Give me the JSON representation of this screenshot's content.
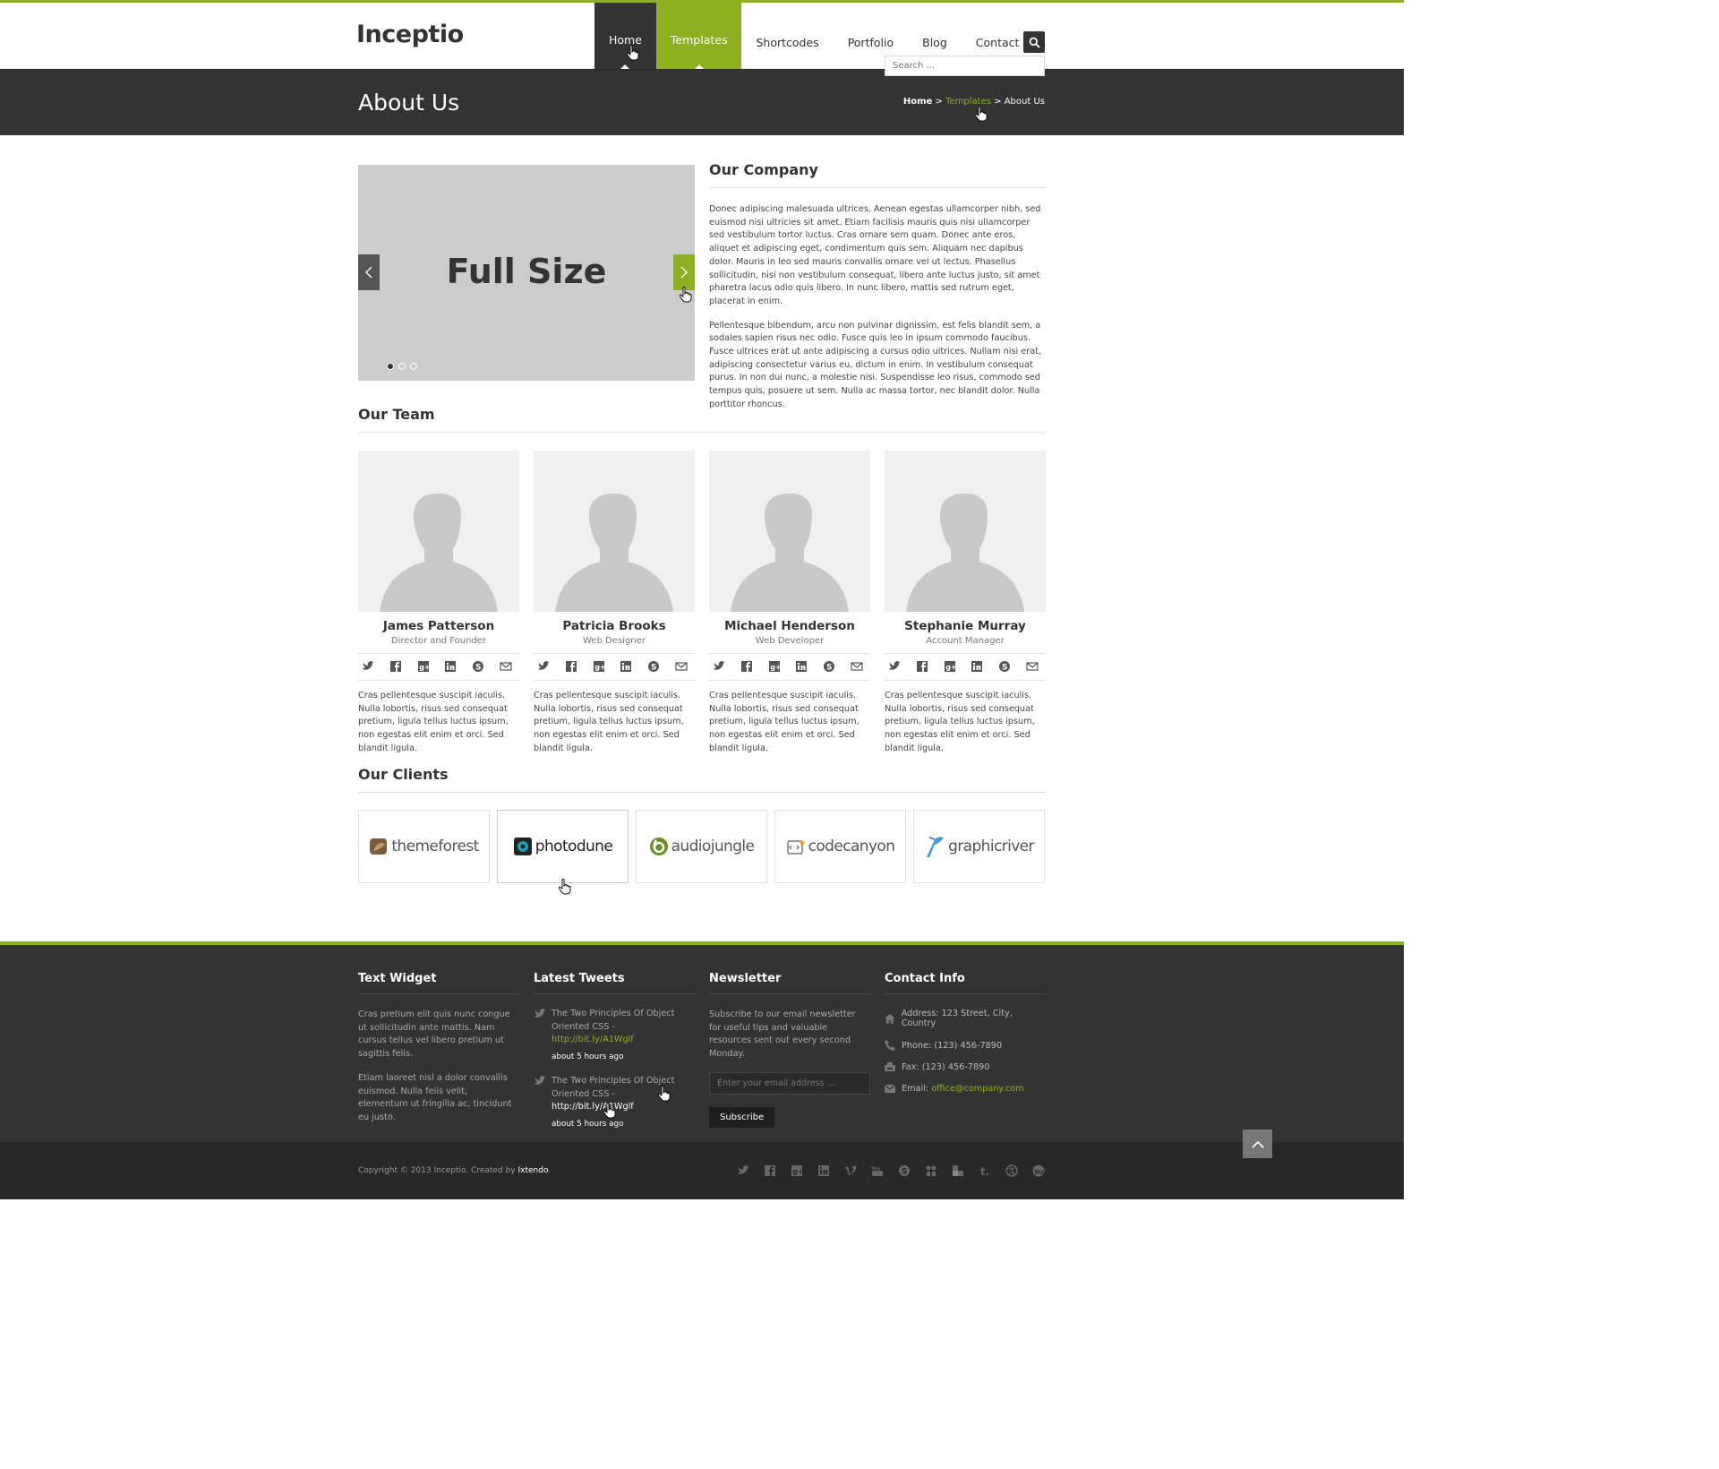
{
  "header": {
    "logo": "Inceptio",
    "nav": [
      "Home",
      "Templates",
      "Shortcodes",
      "Portfolio",
      "Blog",
      "Contact"
    ],
    "search_placeholder": "Search ..."
  },
  "page": {
    "title": "About Us",
    "breadcrumb": {
      "home": "Home",
      "sep": ">",
      "templates": "Templates",
      "current": "About Us"
    }
  },
  "slider": {
    "text": "Full Size",
    "dots": 3,
    "active_dot": 1
  },
  "company": {
    "heading": "Our Company",
    "paragraphs": [
      "Donec adipiscing malesuada ultrices. Aenean egestas ullamcorper nibh, sed euismod nisi ultricies sit amet. Etiam facilisis mauris quis nisi ullamcorper sed vestibulum tortor luctus. Cras ornare sem quam. Donec ante eros, aliquet et adipiscing eget, condimentum quis sem. Aliquam nec dapibus dolor. Mauris in leo sed mauris convallis ornare vel ut lectus. Phasellus sollicitudin, nisi non vestibulum consequat, libero ante luctus justo, sit amet pharetra lacus odio quis libero. In nunc libero, mattis sed rutrum eget, placerat in enim.",
      "Pellentesque bibendum, arcu non pulvinar dignissim, est felis blandit sem, a sodales sapien risus nec odio. Fusce quis leo in ipsum commodo faucibus. Fusce ultrices erat ut ante adipiscing a cursus odio ultrices. Nullam nisi erat, adipiscing consectetur varius eu, dictum in enim. In vestibulum consequat purus. In non dui nunc, a molestie nisi. Suspendisse leo risus, commodo sed tempus quis, posuere ut sem. Nulla ac massa tortor, nec blandit dolor. Nulla porttitor rhoncus."
    ]
  },
  "team": {
    "heading": "Our Team",
    "members": [
      {
        "name": "James Patterson",
        "role": "Director and Founder",
        "bio": "Cras pellentesque suscipit iaculis. Nulla lobortis, risus sed consequat pretium, ligula tellus luctus ipsum, non egestas elit enim et orci. Sed blandit ligula."
      },
      {
        "name": "Patricia Brooks",
        "role": "Web Designer",
        "bio": "Cras pellentesque suscipit iaculis. Nulla lobortis, risus sed consequat pretium, ligula tellus luctus ipsum, non egestas elit enim et orci. Sed blandit ligula."
      },
      {
        "name": "Michael Henderson",
        "role": "Web Developer",
        "bio": "Cras pellentesque suscipit iaculis. Nulla lobortis, risus sed consequat pretium, ligula tellus luctus ipsum, non egestas elit enim et orci. Sed blandit ligula."
      },
      {
        "name": "Stephanie Murray",
        "role": "Account Manager",
        "bio": "Cras pellentesque suscipit iaculis. Nulla lobortis, risus sed consequat pretium, ligula tellus luctus ipsum, non egestas elit enim et orci. Sed blandit ligula."
      }
    ],
    "social_icons": [
      "twitter-icon",
      "facebook-icon",
      "google-plus-icon",
      "linkedin-icon",
      "skype-icon",
      "email-icon"
    ]
  },
  "clients": {
    "heading": "Our Clients",
    "logos": [
      "themeforest",
      "photodune",
      "audiojungle",
      "codecanyon",
      "graphicriver"
    ]
  },
  "footer": {
    "text_widget": {
      "heading": "Text Widget",
      "paragraphs": [
        "Cras pretium elit quis nunc congue ut sollicitudin ante mattis. Nam cursus tellus vel libero pretium ut sagittis felis.",
        "Etiam laoreet nisl a dolor convallis euismod. Nulla felis velit, elementum ut fringilla ac, tincidunt eu justo."
      ]
    },
    "tweets": {
      "heading": "Latest Tweets",
      "items": [
        {
          "text": "The Two Principles Of Object Oriented CSS - ",
          "link": "http://bit.ly/A1Wglf",
          "time": "about 5 hours ago"
        },
        {
          "text": "The Two Principles Of Object Oriented CSS - ",
          "link": "http://bit.ly/A1Wglf",
          "time": "about 5 hours ago"
        }
      ]
    },
    "newsletter": {
      "heading": "Newsletter",
      "text": "Subscribe to our email newsletter for useful tips and valuable resources sent out every second Monday.",
      "placeholder": "Enter your email address ...",
      "button": "Subscribe"
    },
    "contact": {
      "heading": "Contact Info",
      "address": "Address: 123 Street, City, Country",
      "phone": "Phone: (123) 456-7890",
      "fax": "Fax: (123) 456-7890",
      "email_label": "Email: ",
      "email": "office@company.com"
    },
    "copyright": "Copyright © 2013 Inceptio. Created by ",
    "author": "Ixtendo",
    "copyright_end": ".",
    "social_icons": [
      "twitter-icon",
      "facebook-icon",
      "google-plus-icon",
      "linkedin-icon",
      "vimeo-icon",
      "youtube-icon",
      "skype-icon",
      "flickr-icon",
      "delicious-icon",
      "tumblr-icon",
      "dribbble-icon",
      "stumbleupon-icon"
    ]
  },
  "colors": {
    "accent": "#8db021",
    "dark": "#333333",
    "darker": "#282828"
  }
}
